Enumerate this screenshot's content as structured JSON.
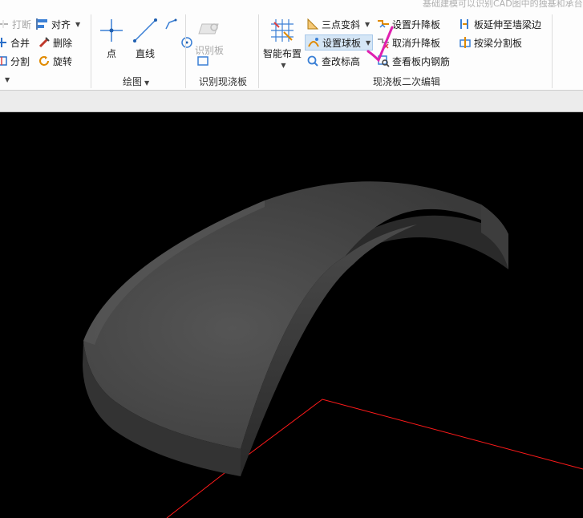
{
  "clipped_tip": "基础建模可以识别CAD图中的独基和承台",
  "modify": {
    "break_label": "打断",
    "merge_label": "合并",
    "split_label": "分割",
    "align_label": "对齐",
    "delete_label": "删除",
    "rotate_label": "旋转"
  },
  "draw": {
    "point_label": "点",
    "line_label": "直线",
    "group_label": "绘图"
  },
  "recognize": {
    "button_label": "识别板",
    "group_label": "识别现浇板"
  },
  "slab_edit": {
    "smart_place_label": "智能布置",
    "three_point_label": "三点变斜",
    "set_sphere_label": "设置球板",
    "modify_elevation_label": "查改标高",
    "set_raise_label": "设置升降板",
    "cancel_raise_label": "取消升降板",
    "view_rebar_label": "查看板内钢筋",
    "extend_label": "板延伸至墙梁边",
    "split_by_beam_label": "按梁分割板",
    "group_label": "现浇板二次编辑"
  },
  "colors": {
    "annotation_check": "#e020b0",
    "axis_line": "#ff1a1a",
    "shell_surface": "#4a4a4a",
    "viewport_bg": "#000000"
  }
}
